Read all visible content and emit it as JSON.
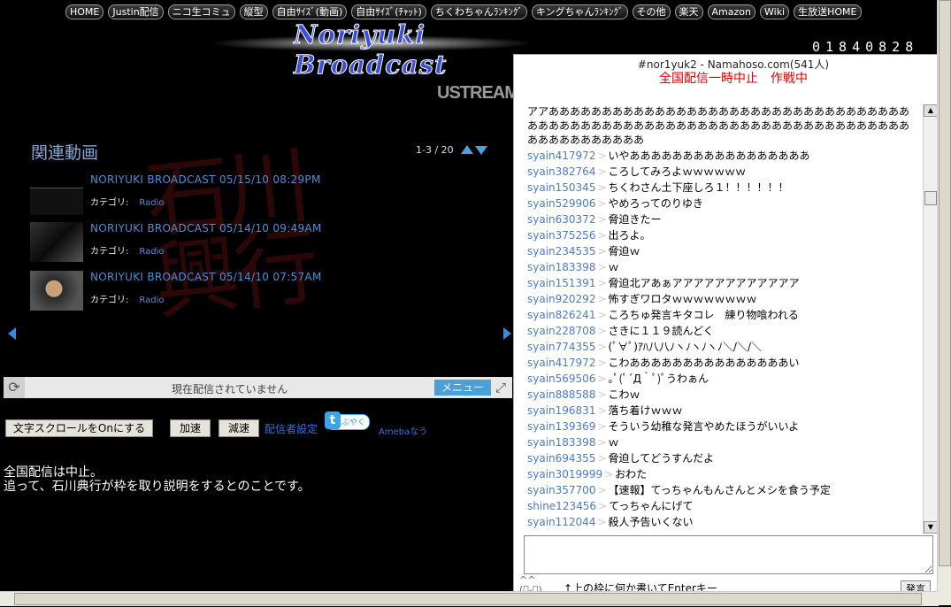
{
  "nav": [
    "HOME",
    "Justin配信",
    "ニコ生コミュ",
    "縦型",
    "自由ｻｲｽﾞ(動画)",
    "自由ｻｲｽﾞ(ﾁｬｯﾄ)",
    "ちくわちゃんﾗﾝｷﾝｸﾞ",
    "キングちゃんﾗﾝｷﾝｸﾞ",
    "その他",
    "楽天",
    "Amazon",
    "Wiki",
    "生放送HOME"
  ],
  "logo_title": "Noriyuki Broadcast",
  "counter": "01840828",
  "ustream_label": "USTREAM",
  "related": {
    "title": "関連動画",
    "page": "1-3 / 20",
    "category_label": "カテゴリ:",
    "videos": [
      {
        "title": "NORIYUKI BROADCAST 05/15/10 08:29PM",
        "category": "Radio"
      },
      {
        "title": "NORIYUKI BROADCAST 05/14/10 09:49AM",
        "category": "Radio"
      },
      {
        "title": "NORIYUKI BROADCAST 05/14/10 07:57AM",
        "category": "Radio"
      }
    ]
  },
  "status": {
    "text": "現在配信されていません",
    "menu": "メニュー"
  },
  "controls": {
    "scroll_on": "文字スクロールをOnにする",
    "speed_up": "加速",
    "speed_down": "減速",
    "settings": "配信者設定",
    "tweet": "つぶやく",
    "ameba": "Amebaなう"
  },
  "notice": [
    "全国配信は中止。",
    "追って、石川典行が枠を取り説明をするとのことです。"
  ],
  "chat": {
    "header": "#nor1yuk2 - Namahoso.com(541人)",
    "subheader": "全国配信一時中止　作戦中",
    "first_message": "アアあああああああああああああああああああああああああああああああああああああああああああああああああああああああああああああああああああああああああああああああああ",
    "messages": [
      {
        "user": "syain417972",
        "text": "いやあああああああああああああああああ"
      },
      {
        "user": "syain382764",
        "text": "ころしてみろよｗｗｗｗｗｗ"
      },
      {
        "user": "syain150345",
        "text": "ちくわさん土下座しろ１！！！！！！"
      },
      {
        "user": "syain529906",
        "text": "やめろってのりゆき"
      },
      {
        "user": "syain630372",
        "text": "脅迫きたー"
      },
      {
        "user": "syain375256",
        "text": "出ろよ。"
      },
      {
        "user": "syain234535",
        "text": "脅迫ｗ"
      },
      {
        "user": "syain183398",
        "text": "ｗ"
      },
      {
        "user": "syain151391",
        "text": "脅迫北アあぁアアアアアアアアアアアア"
      },
      {
        "user": "syain920292",
        "text": "怖すぎワロタｗｗｗｗｗｗｗｗ"
      },
      {
        "user": "syain826241",
        "text": "ころちゅ発言キタコレ　練り物喰われる"
      },
      {
        "user": "syain228708",
        "text": "さきに１１９読んどく"
      },
      {
        "user": "syain774355",
        "text": "(ﾟ∀ﾟ)ｱﾊ八八ﾉヽﾉヽﾉヽﾉ＼/＼/＼"
      },
      {
        "user": "syain417972",
        "text": "こわあああああああああああああああい"
      },
      {
        "user": "syain569506",
        "text": "｡ﾟ(ﾟ´Д｀ﾟ)ﾟうわぁん"
      },
      {
        "user": "syain888588",
        "text": "こわｗ"
      },
      {
        "user": "syain196831",
        "text": "落ち着けｗｗｗ"
      },
      {
        "user": "syain139369",
        "text": "そういう幼稚な発言やめたほうがいいよ"
      },
      {
        "user": "syain183398",
        "text": "ｗ"
      },
      {
        "user": "syain694355",
        "text": "脅迫してどうすんだよ"
      },
      {
        "user": "syain3019999",
        "text": "おわた"
      },
      {
        "user": "syain357700",
        "text": "【速報】てっちゃんもんさんとメシを食う予定"
      },
      {
        "user": "shine123456",
        "text": "てっちゃんにげて"
      },
      {
        "user": "syain112044",
        "text": "殺人予告いくない"
      }
    ],
    "hint": "↑上の枠に何か書いてEnterキー",
    "send": "発言"
  }
}
